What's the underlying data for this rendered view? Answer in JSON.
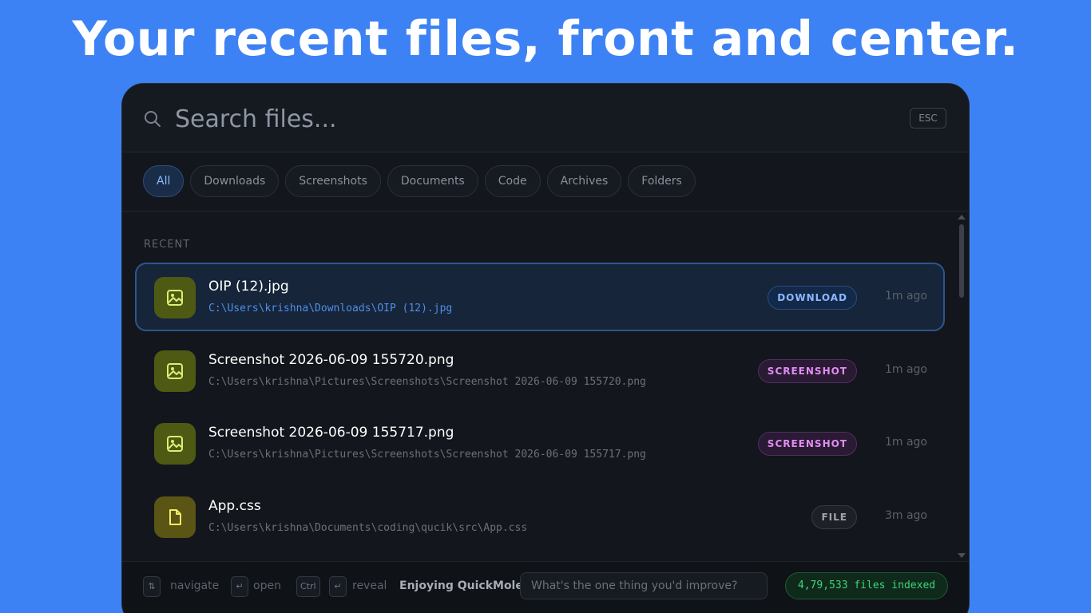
{
  "headline": "Your recent files, front and center.",
  "search": {
    "placeholder": "Search files...",
    "esc_label": "ESC",
    "icon": "search-icon"
  },
  "filters": [
    {
      "label": "All",
      "active": true
    },
    {
      "label": "Downloads",
      "active": false
    },
    {
      "label": "Screenshots",
      "active": false
    },
    {
      "label": "Documents",
      "active": false
    },
    {
      "label": "Code",
      "active": false
    },
    {
      "label": "Archives",
      "active": false
    },
    {
      "label": "Folders",
      "active": false
    }
  ],
  "section_label": "RECENT",
  "files": [
    {
      "name": "OIP (12).jpg",
      "path": "C:\\Users\\krishna\\Downloads\\OIP (12).jpg",
      "badge": "DOWNLOAD",
      "time": "1m ago",
      "icon": "image-icon",
      "selected": true
    },
    {
      "name": "Screenshot 2026-06-09 155720.png",
      "path": "C:\\Users\\krishna\\Pictures\\Screenshots\\Screenshot 2026-06-09 155720.png",
      "badge": "SCREENSHOT",
      "time": "1m ago",
      "icon": "image-icon",
      "selected": false
    },
    {
      "name": "Screenshot 2026-06-09 155717.png",
      "path": "C:\\Users\\krishna\\Pictures\\Screenshots\\Screenshot 2026-06-09 155717.png",
      "badge": "SCREENSHOT",
      "time": "1m ago",
      "icon": "image-icon",
      "selected": false
    },
    {
      "name": "App.css",
      "path": "C:\\Users\\krishna\\Documents\\coding\\qucik\\src\\App.css",
      "badge": "FILE",
      "time": "3m ago",
      "icon": "file-icon",
      "selected": false
    }
  ],
  "footer": {
    "navigate_key": "⇅",
    "navigate_label": "navigate",
    "open_key": "↵",
    "open_label": "open",
    "ctrl_key": "Ctrl",
    "reveal_key": "↵",
    "reveal_label": "reveal",
    "enjoy_text": "Enjoying QuickMole?",
    "feedback_placeholder": "What's the one thing you'd improve?",
    "indexed_text": "4,79,533 files indexed"
  },
  "colors": {
    "background": "#3d82f4",
    "panel": "#13161c",
    "accent_blue": "#8db8ff",
    "screenshot_badge": "#e28cf5",
    "indexed_green": "#3fd47a",
    "icon_bg": "#4e5a14"
  }
}
